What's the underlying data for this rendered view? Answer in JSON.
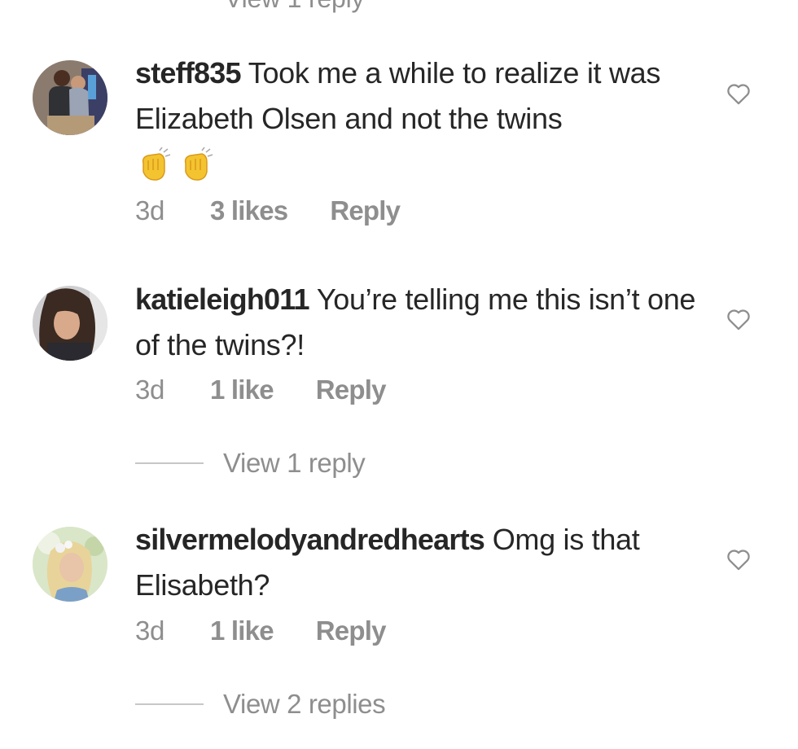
{
  "top_partial": {
    "label": "View 1 reply"
  },
  "comments": [
    {
      "username": "steff835",
      "text": "Took me a while to realize it was Elizabeth Olsen and not the twins",
      "emojis": [
        "👏",
        "👏"
      ],
      "time": "3d",
      "likes": "3 likes",
      "reply_label": "Reply",
      "like_icon": "heart-outline-icon"
    },
    {
      "username": "katieleigh011",
      "text": "You’re telling me this isn’t one of the twins?!",
      "time": "3d",
      "likes": "1 like",
      "reply_label": "Reply",
      "view_replies": "View 1 reply",
      "like_icon": "heart-outline-icon"
    },
    {
      "username": "silvermelodyandredhearts",
      "text": "Omg is that Elisabeth?",
      "time": "3d",
      "likes": "1 like",
      "reply_label": "Reply",
      "view_replies": "View 2 replies",
      "like_icon": "heart-outline-icon"
    }
  ],
  "colors": {
    "text": "#262626",
    "secondary": "#8e8e8e",
    "divider": "#c7c7c7",
    "background": "#ffffff"
  }
}
